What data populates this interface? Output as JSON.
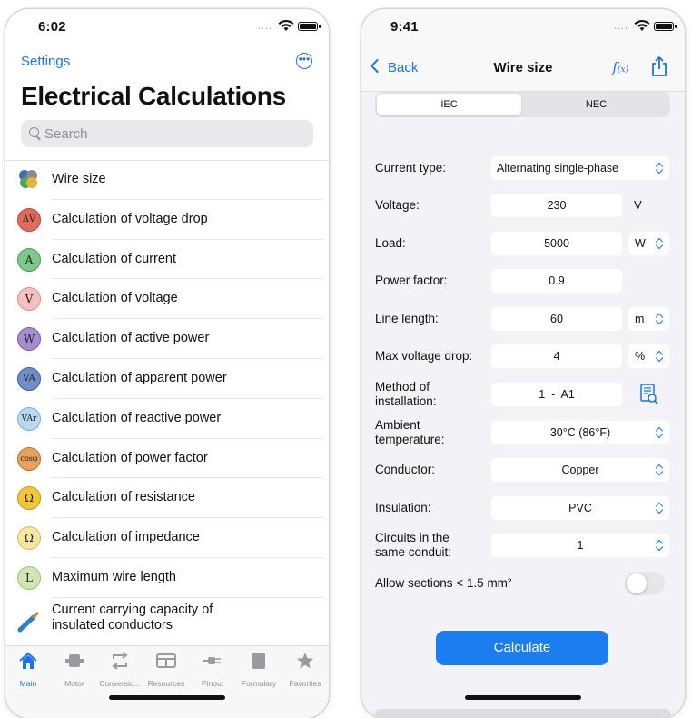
{
  "left": {
    "time": "6:02",
    "signal": "....",
    "settings_label": "Settings",
    "more_label": "•••",
    "title": "Electrical Calculations",
    "search_placeholder": "Search",
    "items": [
      {
        "label": "Wire size",
        "icon": "wire-size-icon",
        "glyph": "",
        "color": "#ffffff"
      },
      {
        "label": "Calculation of voltage drop",
        "icon": "voltage-drop-icon",
        "glyph": "ΔV",
        "color": "#e06a5c"
      },
      {
        "label": "Calculation of current",
        "icon": "current-icon",
        "glyph": "A",
        "color": "#7cc98a"
      },
      {
        "label": "Calculation of voltage",
        "icon": "voltage-icon",
        "glyph": "V",
        "color": "#f5b3b3"
      },
      {
        "label": "Calculation of active power",
        "icon": "active-power-icon",
        "glyph": "W",
        "color": "#a98bd0"
      },
      {
        "label": "Calculation of apparent power",
        "icon": "apparent-power-icon",
        "glyph": "VA",
        "color": "#6c8fc7"
      },
      {
        "label": "Calculation of reactive power",
        "icon": "reactive-power-icon",
        "glyph": "VAr",
        "color": "#a8cde6"
      },
      {
        "label": "Calculation of power factor",
        "icon": "power-factor-icon",
        "glyph": "cosφ",
        "color": "#e8a05a"
      },
      {
        "label": "Calculation of resistance",
        "icon": "resistance-icon",
        "glyph": "Ω",
        "color": "#f2c637"
      },
      {
        "label": "Calculation of impedance",
        "icon": "impedance-icon",
        "glyph": "Ω",
        "color": "#f6e6a0"
      },
      {
        "label": "Maximum wire length",
        "icon": "wire-length-icon",
        "glyph": "L",
        "color": "#cfe7b5"
      },
      {
        "label": "Current carrying capacity of insulated conductors",
        "icon": "insulated-conductor-icon",
        "glyph": "",
        "color": "#ffffff"
      }
    ],
    "tabs": [
      {
        "label": "Main",
        "icon": "home-icon"
      },
      {
        "label": "Motor",
        "icon": "motor-icon"
      },
      {
        "label": "Conversio...",
        "icon": "conversion-icon"
      },
      {
        "label": "Resources",
        "icon": "resources-icon"
      },
      {
        "label": "Pinout",
        "icon": "pinout-icon"
      },
      {
        "label": "Formulary",
        "icon": "formulary-icon"
      },
      {
        "label": "Favorites",
        "icon": "star-icon"
      }
    ]
  },
  "right": {
    "time": "9:41",
    "signal": "....",
    "back_label": "Back",
    "title": "Wire size",
    "fx_label": "f",
    "fx_sub": "(x)",
    "segments": [
      "IEC",
      "NEC"
    ],
    "fields": {
      "current_type": {
        "label": "Current type:",
        "value": "Alternating single-phase"
      },
      "voltage": {
        "label": "Voltage:",
        "value": "230",
        "unit": "V"
      },
      "load": {
        "label": "Load:",
        "value": "5000",
        "unit": "W"
      },
      "power_factor": {
        "label": "Power factor:",
        "value": "0.9"
      },
      "line_length": {
        "label": "Line length:",
        "value": "60",
        "unit": "m"
      },
      "max_voltage_drop": {
        "label": "Max voltage drop:",
        "value": "4",
        "unit": "%"
      },
      "method": {
        "label": "Method of installation:",
        "value": "1  -  A1"
      },
      "ambient": {
        "label": "Ambient temperature:",
        "value": "30°C (86°F)"
      },
      "conductor": {
        "label": "Conductor:",
        "value": "Copper"
      },
      "insulation": {
        "label": "Insulation:",
        "value": "PVC"
      },
      "circuits": {
        "label": "Circuits in the same conduit:",
        "value": "1"
      },
      "allow_sections": {
        "label": "Allow sections < 1.5 mm²",
        "enabled": false
      }
    },
    "calculate_label": "Calculate"
  },
  "colors": {
    "accent": "#1a73e8",
    "button": "#1a7df0"
  }
}
